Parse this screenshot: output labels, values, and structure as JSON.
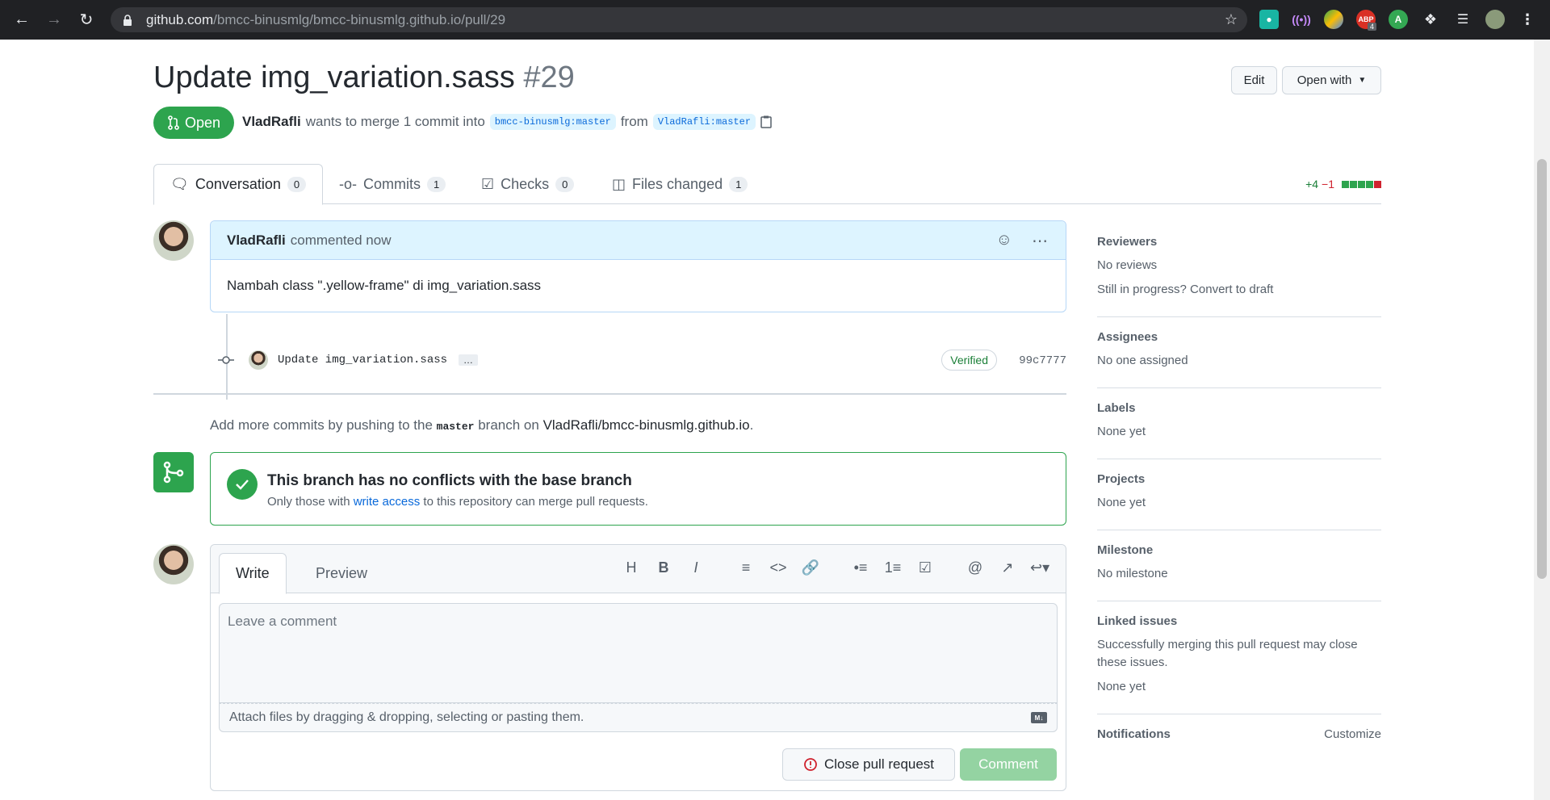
{
  "browser": {
    "url_host": "github.com",
    "url_path": "/bmcc-binusmlg/bmcc-binusmlg.github.io/pull/29",
    "abp_badge": "4",
    "ext_a_label": "A"
  },
  "pr": {
    "title": "Update img_variation.sass",
    "number": "#29",
    "edit_label": "Edit",
    "open_with_label": "Open with",
    "state_label": "Open",
    "author": "VladRafli",
    "merge_text": "wants to merge 1 commit into",
    "base_branch": "bmcc-binusmlg:master",
    "from_text": "from",
    "head_branch": "VladRafli:master"
  },
  "tabs": [
    {
      "label": "Conversation",
      "count": "0"
    },
    {
      "label": "Commits",
      "count": "1"
    },
    {
      "label": "Checks",
      "count": "0"
    },
    {
      "label": "Files changed",
      "count": "1"
    }
  ],
  "diffstat": {
    "additions": "+4",
    "deletions": "−1"
  },
  "comment": {
    "author": "VladRafli",
    "meta": "commented now",
    "body": "Nambah class \".yellow-frame\" di img_variation.sass"
  },
  "commit": {
    "message": "Update img_variation.sass",
    "ellipsis": "…",
    "verified": "Verified",
    "sha": "99c7777"
  },
  "push_note": {
    "prefix": "Add more commits by pushing to the",
    "branch": "master",
    "middle": "branch on",
    "repo": "VladRafli/bmcc-binusmlg.github.io",
    "suffix": "."
  },
  "merge": {
    "heading": "This branch has no conflicts with the base branch",
    "sub_prefix": "Only those with",
    "sub_link": "write access",
    "sub_suffix": "to this repository can merge pull requests."
  },
  "editor": {
    "write_tab": "Write",
    "preview_tab": "Preview",
    "placeholder": "Leave a comment",
    "attach_text": "Attach files by dragging & dropping, selecting or pasting them.",
    "close_label": "Close pull request",
    "comment_label": "Comment"
  },
  "sidebar": {
    "reviewers": {
      "heading": "Reviewers",
      "value": "No reviews",
      "extra": "Still in progress? Convert to draft"
    },
    "assignees": {
      "heading": "Assignees",
      "value": "No one assigned"
    },
    "labels": {
      "heading": "Labels",
      "value": "None yet"
    },
    "projects": {
      "heading": "Projects",
      "value": "None yet"
    },
    "milestone": {
      "heading": "Milestone",
      "value": "No milestone"
    },
    "linked": {
      "heading": "Linked issues",
      "desc": "Successfully merging this pull request may close these issues.",
      "value": "None yet"
    },
    "notifications": {
      "heading": "Notifications",
      "action": "Customize"
    }
  },
  "colors": {
    "accent_green": "#2da44e",
    "link_blue": "#0969da",
    "chrome_dark": "#202124"
  }
}
